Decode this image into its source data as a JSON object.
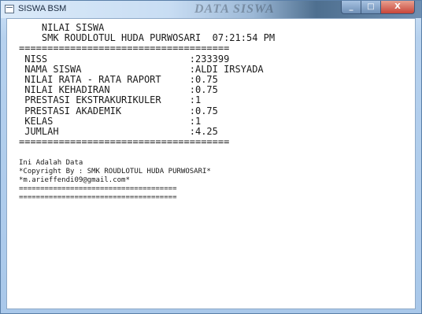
{
  "window": {
    "title": "SISWA BSM",
    "watermark": "DATA SISWA",
    "controls": [
      "_",
      "□",
      "X"
    ]
  },
  "console": {
    "lines": [
      "    NILAI SISWA",
      "    SMK ROUDLOTUL HUDA PURWOSARI  07:21:54 PM",
      "=====================================",
      " NISS                         :233399",
      " NAMA SISWA                   :ALDI IRSYADA",
      " NILAI RATA - RATA RAPORT     :0.75",
      " NILAI KEHADIRAN              :0.75",
      " PRESTASI EKSTRAKURIKULER     :1",
      " PRESTASI AKADEMIK            :0.75",
      " KELAS                        :1",
      " JUMLAH                       :4.25",
      "====================================="
    ],
    "footer_lines": [
      "Ini Adalah Data",
      "*Copyright By : SMK ROUDLOTUL HUDA PURWOSARI*",
      "*m.arieffendi09@gmail.com*",
      "=====================================",
      "====================================="
    ]
  }
}
